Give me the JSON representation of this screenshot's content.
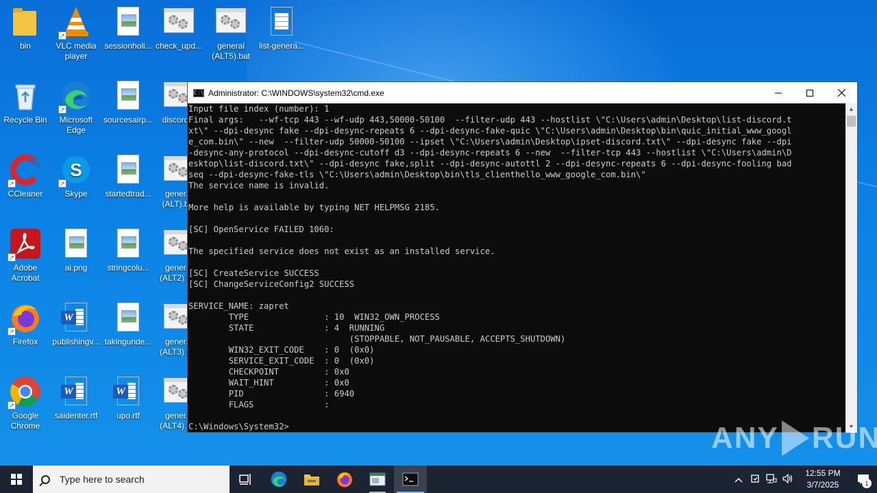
{
  "desktop": {
    "icons": [
      {
        "label": "bin"
      },
      {
        "label": "VLC media player"
      },
      {
        "label": "sessionholi..."
      },
      {
        "label": "check_upd..."
      },
      {
        "label": "general (ALT5).bat"
      },
      {
        "label": "list-genera..."
      },
      {
        "label": "Recycle Bin"
      },
      {
        "label": "Microsoft Edge"
      },
      {
        "label": "sourcesairp..."
      },
      {
        "label": "discord..."
      },
      {
        "label": "CCleaner"
      },
      {
        "label": "Skype"
      },
      {
        "label": "startedtrad..."
      },
      {
        "label": "gener... (ALT).b..."
      },
      {
        "label": "Adobe Acrobat"
      },
      {
        "label": "ai.png"
      },
      {
        "label": "stringcolu..."
      },
      {
        "label": "gener... (ALT2).b..."
      },
      {
        "label": "Firefox"
      },
      {
        "label": "publishingv..."
      },
      {
        "label": "takingunde..."
      },
      {
        "label": "gener... (ALT3).b..."
      },
      {
        "label": "Google Chrome"
      },
      {
        "label": "saidenter.rtf"
      },
      {
        "label": "upo.rtf"
      },
      {
        "label": "gener... (ALT4).b..."
      }
    ]
  },
  "cmd_window": {
    "title": "Administrator: C:\\WINDOWS\\system32\\cmd.exe",
    "lines": [
      "Input file index (number): 1",
      "Final args:   --wf-tcp 443 --wf-udp 443,50000-50100  --filter-udp 443 --hostlist \\\"C:\\Users\\admin\\Desktop\\list-discord.t",
      "xt\\\" --dpi-desync fake --dpi-desync-repeats 6 --dpi-desync-fake-quic \\\"C:\\Users\\admin\\Desktop\\bin\\quic_initial_www_googl",
      "e_com.bin\\\" --new  --filter-udp 50000-50100 --ipset \\\"C:\\Users\\admin\\Desktop\\ipset-discord.txt\\\" --dpi-desync fake --dpi",
      "-desync-any-protocol --dpi-desync-cutoff d3 --dpi-desync-repeats 6 --new  --filter-tcp 443 --hostlist \\\"C:\\Users\\admin\\D",
      "esktop\\list-discord.txt\\\" --dpi-desync fake,split --dpi-desync-autottl 2 --dpi-desync-repeats 6 --dpi-desync-fooling bad",
      "seq --dpi-desync-fake-tls \\\"C:\\Users\\admin\\Desktop\\bin\\tls_clienthello_www_google_com.bin\\\"",
      "The service name is invalid.",
      "",
      "More help is available by typing NET HELPMSG 2185.",
      "",
      "[SC] OpenService FAILED 1060:",
      "",
      "The specified service does not exist as an installed service.",
      "",
      "[SC] CreateService SUCCESS",
      "[SC] ChangeServiceConfig2 SUCCESS",
      "",
      "SERVICE_NAME: zapret",
      "        TYPE               : 10  WIN32_OWN_PROCESS",
      "        STATE              : 4  RUNNING",
      "                                (STOPPABLE, NOT_PAUSABLE, ACCEPTS_SHUTDOWN)",
      "        WIN32_EXIT_CODE    : 0  (0x0)",
      "        SERVICE_EXIT_CODE  : 0  (0x0)",
      "        CHECKPOINT         : 0x0",
      "        WAIT_HINT          : 0x0",
      "        PID                : 6940",
      "        FLAGS              :",
      "",
      "C:\\Windows\\System32>"
    ]
  },
  "watermark": {
    "left": "ANY",
    "right": "RUN"
  },
  "taskbar": {
    "search_placeholder": "Type here to search",
    "time": "12:55 PM",
    "date": "3/7/2025",
    "notification_count": "1"
  }
}
